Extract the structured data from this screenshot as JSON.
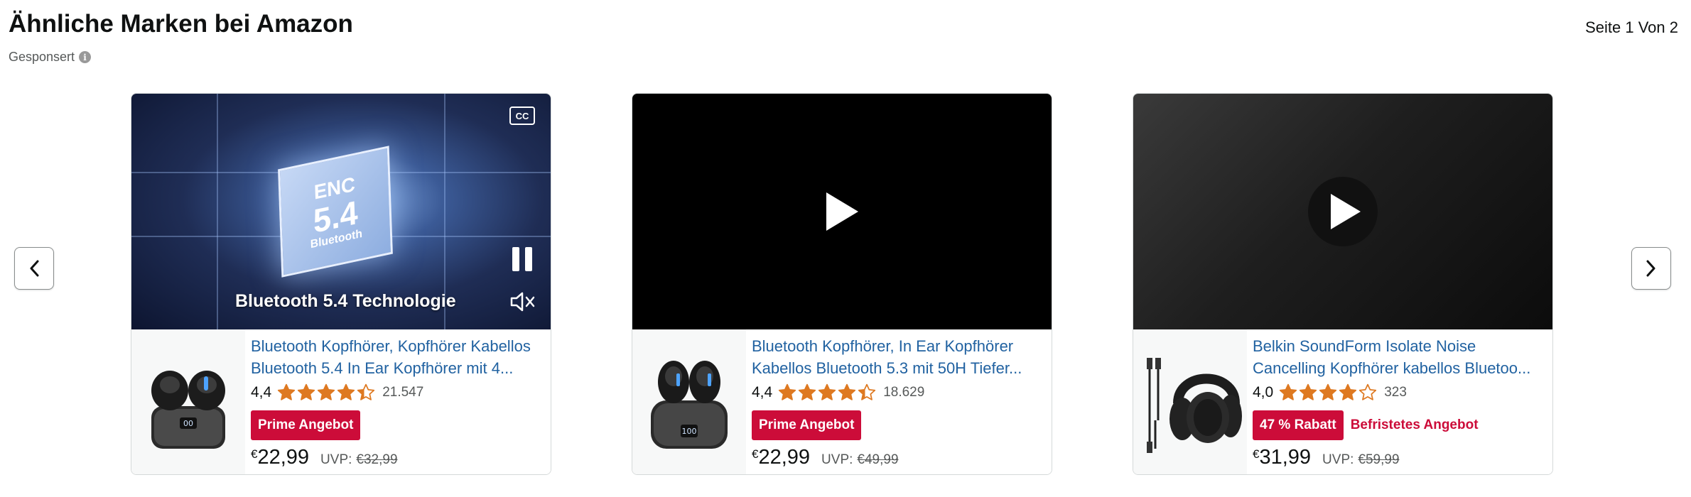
{
  "header": {
    "title": "Ähnliche Marken bei Amazon",
    "sponsored": "Gesponsert",
    "info_glyph": "i",
    "page_indicator": "Seite 1 Von 2"
  },
  "nav": {
    "prev_icon": "chevron-left-icon",
    "next_icon": "chevron-right-icon"
  },
  "cards": [
    {
      "video": {
        "state": "playing",
        "caption": "Bluetooth 5.4 Technologie",
        "cc": "CC",
        "chip_text": [
          "ENC",
          "5.4",
          "Bluetooth"
        ]
      },
      "title": "Bluetooth Kopfhörer, Kopfhörer Kabellos Bluetooth 5.4 In Ear Kopfhörer mit 4...",
      "rating": "4,4",
      "stars": 4.4,
      "reviews": "21.547",
      "badge": "Prime Angebot",
      "deal_text": "",
      "currency": "€",
      "price": "22,99",
      "uvp_label": "UVP:",
      "uvp": "€32,99"
    },
    {
      "video": {
        "state": "paused"
      },
      "title": "Bluetooth Kopfhörer, In Ear Kopfhörer Kabellos Bluetooth 5.3 mit 50H Tiefer...",
      "rating": "4,4",
      "stars": 4.4,
      "reviews": "18.629",
      "badge": "Prime Angebot",
      "deal_text": "",
      "currency": "€",
      "price": "22,99",
      "uvp_label": "UVP:",
      "uvp": "€49,99"
    },
    {
      "video": {
        "state": "paused"
      },
      "title": "Belkin SoundForm Isolate Noise Cancelling Kopfhörer kabellos Bluetoo...",
      "rating": "4,0",
      "stars": 4.0,
      "reviews": "323",
      "badge": "47 % Rabatt",
      "deal_text": "Befristetes Angebot",
      "currency": "€",
      "price": "31,99",
      "uvp_label": "UVP:",
      "uvp": "€59,99"
    }
  ],
  "colors": {
    "link": "#2162a1",
    "star": "#de7921",
    "badge": "#cc0c39",
    "text": "#0f1111",
    "muted": "#565959"
  }
}
